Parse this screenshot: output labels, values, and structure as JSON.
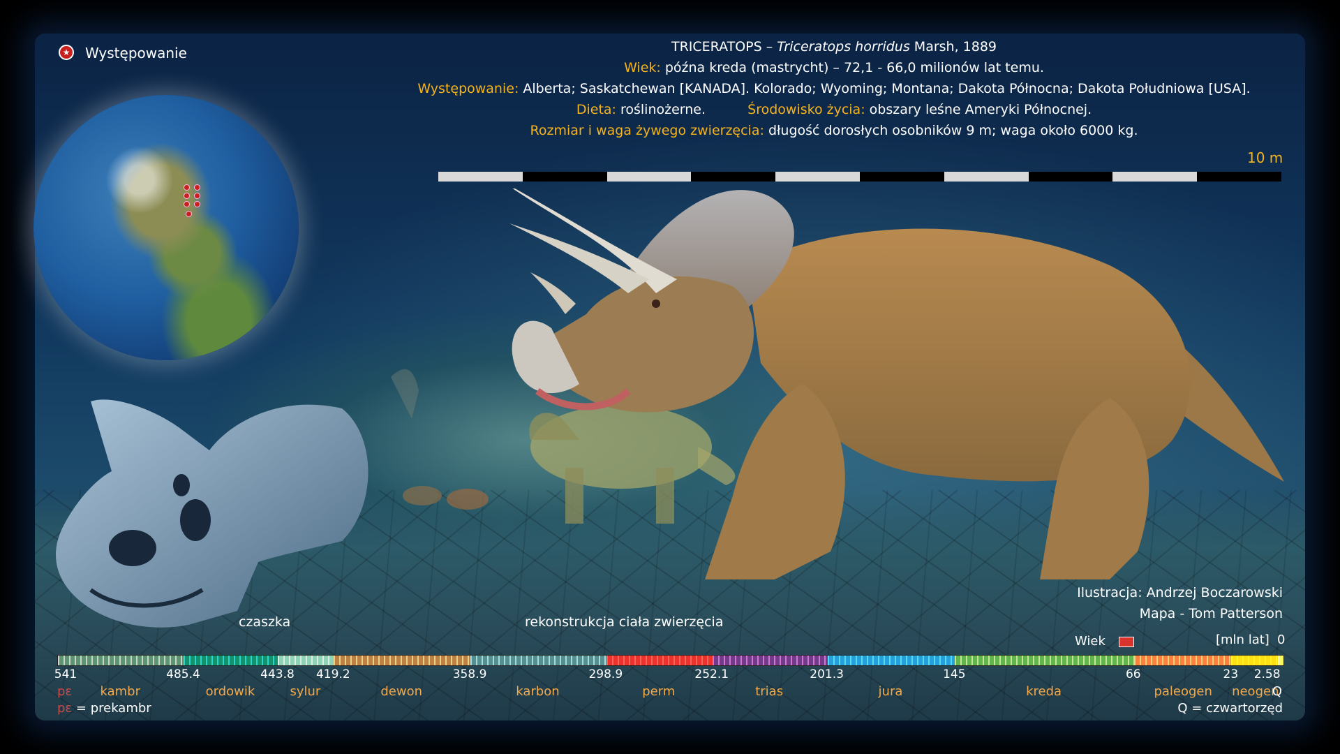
{
  "header": {
    "name": "TRICERATOPS",
    "dash": "–",
    "species": "Triceratops  horridus",
    "author": "Marsh,  1889",
    "age_label": "Wiek:",
    "age_value": "późna kreda (mastrycht) – 72,1 - 66,0 milionów lat temu.",
    "occurrence_label": "Występowanie:",
    "occurrence_value": "Alberta; Saskatchewan [KANADA]. Kolorado; Wyoming; Montana; Dakota Północna; Dakota Południowa [USA].",
    "diet_label": "Dieta:",
    "diet_value": "roślinożerne.",
    "habitat_label": "Środowisko życia:",
    "habitat_value": "obszary leśne Ameryki Północnej.",
    "size_label": "Rozmiar i waga żywego zwierzęcia:",
    "size_value": "długość dorosłych osobników 9 m; waga około 6000 kg."
  },
  "legend": {
    "occurrence": "Występowanie"
  },
  "scale": {
    "label": "10 m"
  },
  "captions": {
    "skull": "czaszka",
    "reconstruction": "rekonstrukcja ciała zwierzęcia",
    "illustration": "Ilustracja: Andrzej Boczarowski",
    "map": "Mapa - Tom Patterson"
  },
  "timeline": {
    "age_label": "Wiek",
    "unit_label": "[mln lat]",
    "zero": "0",
    "ticks": [
      "541",
      "485.4",
      "443.8",
      "419.2",
      "358.9",
      "298.9",
      "252.1",
      "201.3",
      "145",
      "66",
      "23",
      "2.58"
    ],
    "periods": [
      "kambr",
      "ordowik",
      "sylur",
      "dewon",
      "karbon",
      "perm",
      "trias",
      "jura",
      "kreda",
      "paleogen",
      "neogen",
      "Q"
    ],
    "pe_abbr": "pε",
    "pe_legend": "= prekambr",
    "q_legend": "Q = czwartorzęd",
    "colors": {
      "kambr": "#7fa98e",
      "ordowik": "#1aa88a",
      "sylur": "#a6dbc5",
      "dewon": "#cb9a5a",
      "karbon": "#6fa6a7",
      "perm": "#f0423c",
      "trias": "#8f4da0",
      "jura": "#34b2e2",
      "kreda": "#80c564",
      "paleogen": "#fd9a52",
      "neogen": "#ffe619",
      "Q": "#f9f97f"
    }
  }
}
